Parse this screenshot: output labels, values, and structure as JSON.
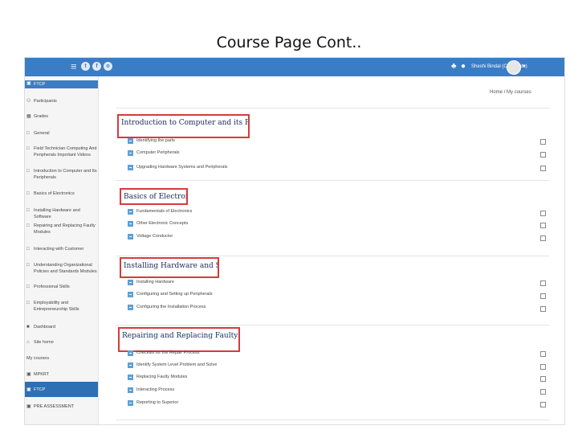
{
  "slide_title": "Course Page Cont..",
  "topbar": {
    "menu_glyph": "≡",
    "social": [
      "t",
      "f",
      "o"
    ],
    "bell_glyph": "♣",
    "chat_glyph": "●",
    "user_name": "Sheshi Bindal (Candidate)",
    "caret": "▾"
  },
  "sidebar": {
    "items": [
      {
        "label": "FTCP",
        "icon": "graduation-cap",
        "glyph": "▣"
      },
      {
        "label": "Participants",
        "icon": "users",
        "glyph": "⚇"
      },
      {
        "label": "Grades",
        "icon": "grades",
        "glyph": "▦"
      },
      {
        "label": "General",
        "icon": "folder",
        "glyph": "□"
      },
      {
        "label": "Field Technician Computing And Peripherals Important Videos",
        "icon": "folder",
        "glyph": "□"
      },
      {
        "label": "Introduction to Computer and Its Peripherals",
        "icon": "folder",
        "glyph": "□"
      },
      {
        "label": "Basics of Electronics",
        "icon": "folder",
        "glyph": "□"
      },
      {
        "label": "Installing Hardware and Software",
        "icon": "folder",
        "glyph": "□"
      },
      {
        "label": "Repairing and Replacing Faulty Modules",
        "icon": "folder",
        "glyph": "□"
      },
      {
        "label": "Interacting with Customer",
        "icon": "folder",
        "glyph": "□"
      },
      {
        "label": "Understanding Organizational Policies and Standards Modules",
        "icon": "folder",
        "glyph": "□"
      },
      {
        "label": "Professional Skills",
        "icon": "folder",
        "glyph": "□"
      },
      {
        "label": "Employability and Entrepreneurship Skills",
        "icon": "folder",
        "glyph": "□"
      },
      {
        "label": "Dashboard",
        "icon": "dashboard",
        "glyph": "■"
      },
      {
        "label": "Site home",
        "icon": "home",
        "glyph": "⌂"
      },
      {
        "label": "My courses",
        "icon": "none",
        "glyph": ""
      },
      {
        "label": "MPKRT",
        "icon": "graduation-cap",
        "glyph": "▣"
      },
      {
        "label": "FTCP",
        "icon": "graduation-cap",
        "glyph": "▣"
      },
      {
        "label": "PRE ASSESSMENT",
        "icon": "graduation-cap",
        "glyph": "▣"
      }
    ]
  },
  "breadcrumb": {
    "home": "Home",
    "sep": "/",
    "current": "My courses"
  },
  "sections": [
    {
      "title": "Introduction to Computer and its Peripherals",
      "activities": [
        "Identifying the parts",
        "Computer Peripherals",
        "Upgrading Hardware Systems and Peripherals"
      ]
    },
    {
      "title": "Basics of Electronics",
      "activities": [
        "Fundamentals of Electronics",
        "Other Electronic Concepts",
        "Voltage Conductor"
      ]
    },
    {
      "title": "Installing Hardware and Software",
      "activities": [
        "Installing Hardware",
        "Configuring and Setting up Peripherals",
        "Configuring the Installation Process"
      ]
    },
    {
      "title": "Repairing and Replacing Faulty Modules",
      "activities": [
        "Checklist for the Repair Process",
        "Identify System Level Problem and Solve",
        "Replacing Faulty Modules",
        "Interacting Process",
        "Reporting to Superior"
      ]
    }
  ],
  "colors": {
    "topbar": "#3a7dc4",
    "highlight_box": "#d63b3b",
    "activity_icon": "#5aa0d8",
    "section_title": "#1a2a5a"
  }
}
